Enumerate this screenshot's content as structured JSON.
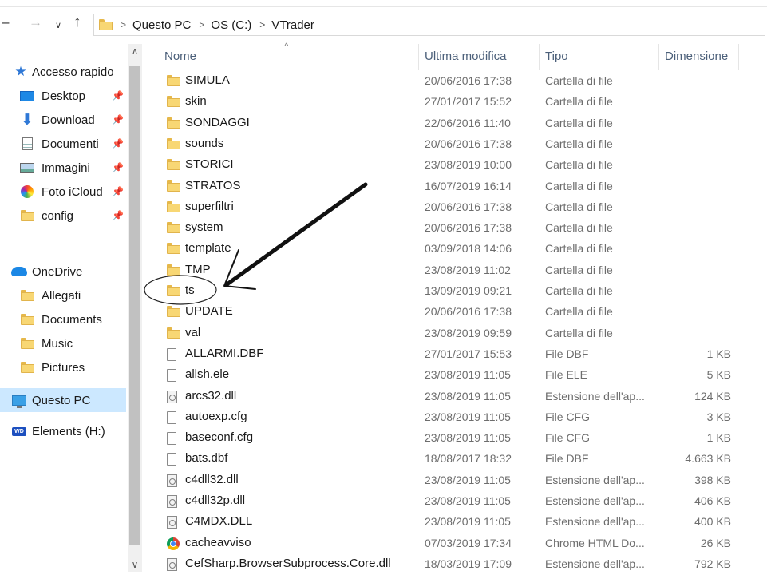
{
  "address_bar": {
    "breadcrumbs": [
      "Questo PC",
      "OS (C:)",
      "VTrader"
    ]
  },
  "sidebar": {
    "quick_access_label": "Accesso rapido",
    "quick_items": [
      {
        "label": "Desktop",
        "icon": "desktop-icon",
        "pinned": true
      },
      {
        "label": "Download",
        "icon": "download-icon",
        "pinned": true
      },
      {
        "label": "Documenti",
        "icon": "documents-icon",
        "pinned": true
      },
      {
        "label": "Immagini",
        "icon": "images-icon",
        "pinned": true
      },
      {
        "label": "Foto iCloud",
        "icon": "icloud-photos-icon",
        "pinned": true
      },
      {
        "label": "config",
        "icon": "folder-icon",
        "pinned": true
      }
    ],
    "onedrive_label": "OneDrive",
    "onedrive_items": [
      "Allegati",
      "Documents",
      "Music",
      "Pictures"
    ],
    "this_pc_label": "Questo PC",
    "drive_label": "Elements (H:)"
  },
  "columns": {
    "name": "Nome",
    "modified": "Ultima modifica",
    "type": "Tipo",
    "size": "Dimensione"
  },
  "files": [
    {
      "name": "SIMULA",
      "date": "20/06/2016 17:38",
      "type": "Cartella di file",
      "size": "",
      "icon": "folder"
    },
    {
      "name": "skin",
      "date": "27/01/2017 15:52",
      "type": "Cartella di file",
      "size": "",
      "icon": "folder"
    },
    {
      "name": "SONDAGGI",
      "date": "22/06/2016 11:40",
      "type": "Cartella di file",
      "size": "",
      "icon": "folder"
    },
    {
      "name": "sounds",
      "date": "20/06/2016 17:38",
      "type": "Cartella di file",
      "size": "",
      "icon": "folder"
    },
    {
      "name": "STORICI",
      "date": "23/08/2019 10:00",
      "type": "Cartella di file",
      "size": "",
      "icon": "folder"
    },
    {
      "name": "STRATOS",
      "date": "16/07/2019 16:14",
      "type": "Cartella di file",
      "size": "",
      "icon": "folder"
    },
    {
      "name": "superfiltri",
      "date": "20/06/2016 17:38",
      "type": "Cartella di file",
      "size": "",
      "icon": "folder"
    },
    {
      "name": "system",
      "date": "20/06/2016 17:38",
      "type": "Cartella di file",
      "size": "",
      "icon": "folder"
    },
    {
      "name": "template",
      "date": "03/09/2018 14:06",
      "type": "Cartella di file",
      "size": "",
      "icon": "folder"
    },
    {
      "name": "TMP",
      "date": "23/08/2019 11:02",
      "type": "Cartella di file",
      "size": "",
      "icon": "folder"
    },
    {
      "name": "ts",
      "date": "13/09/2019 09:21",
      "type": "Cartella di file",
      "size": "",
      "icon": "folder"
    },
    {
      "name": "UPDATE",
      "date": "20/06/2016 17:38",
      "type": "Cartella di file",
      "size": "",
      "icon": "folder"
    },
    {
      "name": "val",
      "date": "23/08/2019 09:59",
      "type": "Cartella di file",
      "size": "",
      "icon": "folder"
    },
    {
      "name": "ALLARMI.DBF",
      "date": "27/01/2017 15:53",
      "type": "File DBF",
      "size": "1 KB",
      "icon": "file"
    },
    {
      "name": "allsh.ele",
      "date": "23/08/2019 11:05",
      "type": "File ELE",
      "size": "5 KB",
      "icon": "file"
    },
    {
      "name": "arcs32.dll",
      "date": "23/08/2019 11:05",
      "type": "Estensione dell'ap...",
      "size": "124 KB",
      "icon": "dll"
    },
    {
      "name": "autoexp.cfg",
      "date": "23/08/2019 11:05",
      "type": "File CFG",
      "size": "3 KB",
      "icon": "file"
    },
    {
      "name": "baseconf.cfg",
      "date": "23/08/2019 11:05",
      "type": "File CFG",
      "size": "1 KB",
      "icon": "file"
    },
    {
      "name": "bats.dbf",
      "date": "18/08/2017 18:32",
      "type": "File DBF",
      "size": "4.663 KB",
      "icon": "file"
    },
    {
      "name": "c4dll32.dll",
      "date": "23/08/2019 11:05",
      "type": "Estensione dell'ap...",
      "size": "398 KB",
      "icon": "dll"
    },
    {
      "name": "c4dll32p.dll",
      "date": "23/08/2019 11:05",
      "type": "Estensione dell'ap...",
      "size": "406 KB",
      "icon": "dll"
    },
    {
      "name": "C4MDX.DLL",
      "date": "23/08/2019 11:05",
      "type": "Estensione dell'ap...",
      "size": "400 KB",
      "icon": "dll"
    },
    {
      "name": "cacheavviso",
      "date": "07/03/2019 17:34",
      "type": "Chrome HTML Do...",
      "size": "26 KB",
      "icon": "chrome"
    },
    {
      "name": "CefSharp.BrowserSubprocess.Core.dll",
      "date": "18/03/2019 17:09",
      "type": "Estensione dell'ap...",
      "size": "792 KB",
      "icon": "dll"
    }
  ]
}
